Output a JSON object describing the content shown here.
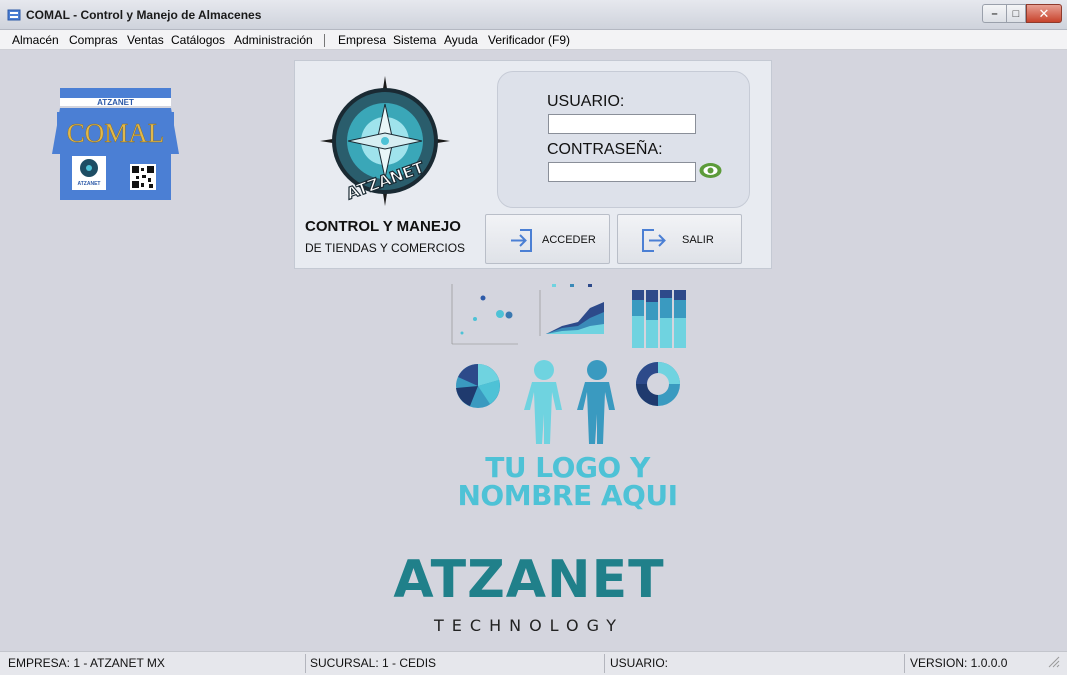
{
  "window": {
    "title": "COMAL - Control y Manejo de Almacenes",
    "min_glyph": "–",
    "max_glyph": "□",
    "close_glyph": "✕"
  },
  "menu": {
    "items": [
      "Almacén",
      "Compras",
      "Ventas",
      "Catálogos",
      "Administración",
      "Empresa",
      "Sistema",
      "Ayuda",
      "Verificador (F9)"
    ]
  },
  "store_logo": {
    "brand_top": "ATZANET",
    "name": "COMAL",
    "small": "ATZANET"
  },
  "login": {
    "emblem_text": "ATZANET",
    "tagline_title": "CONTROL Y MANEJO",
    "tagline_sub": "DE TIENDAS Y COMERCIOS",
    "user_label": "USUARIO:",
    "user_value": "",
    "password_label": "CONTRASEÑA:",
    "password_value": "",
    "access_button": "ACCEDER",
    "exit_button": "SALIR"
  },
  "placeholder": {
    "line1": "TU LOGO Y",
    "line2": "NOMBRE AQUI"
  },
  "brand": {
    "name": "ATZANET",
    "sub": "TECHNOLOGY"
  },
  "status": {
    "empresa": "EMPRESA: 1 - ATZANET MX",
    "sucursal": "SUCURSAL: 1 - CEDIS",
    "usuario": "USUARIO:",
    "version": "VERSION: 1.0.0.0"
  },
  "colors": {
    "accent_teal": "#20808a",
    "placeholder_cyan": "#4ec2d6",
    "store_blue": "#4b7fd4",
    "eye_green": "#5c9b3a"
  },
  "icons": {
    "access": "login-arrow-icon",
    "exit": "logout-arrow-icon",
    "show_password": "eye-icon"
  }
}
